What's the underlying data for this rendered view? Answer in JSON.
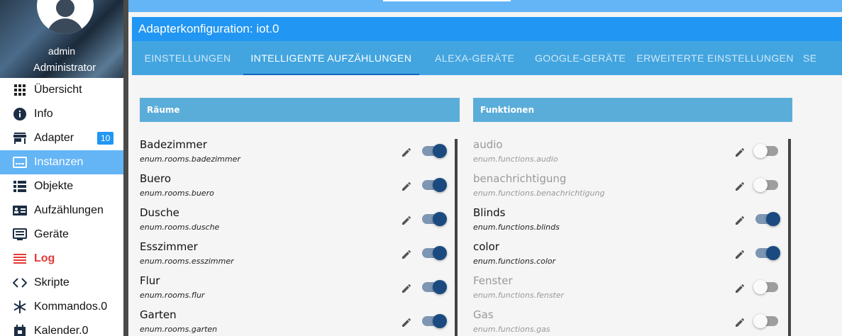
{
  "sidebar": {
    "user_name": "admin",
    "user_role": "Administrator",
    "items": [
      {
        "label": "Übersicht",
        "icon": "grid-icon"
      },
      {
        "label": "Info",
        "icon": "info-icon"
      },
      {
        "label": "Adapter",
        "icon": "store-icon",
        "badge": "10"
      },
      {
        "label": "Instanzen",
        "icon": "instances-icon",
        "active": true
      },
      {
        "label": "Objekte",
        "icon": "list-icon"
      },
      {
        "label": "Aufzählungen",
        "icon": "enum-icon"
      },
      {
        "label": "Geräte",
        "icon": "devices-icon"
      },
      {
        "label": "Log",
        "icon": "log-icon"
      },
      {
        "label": "Skripte",
        "icon": "code-icon"
      },
      {
        "label": "Kommandos.0",
        "icon": "snowflake-icon"
      },
      {
        "label": "Kalender.0",
        "icon": "calendar-icon"
      }
    ]
  },
  "header": {
    "title": "Adapterkonfiguration: iot.0"
  },
  "tabs": [
    {
      "label": "EINSTELLUNGEN"
    },
    {
      "label": "INTELLIGENTE AUFZÄHLUNGEN",
      "active": true
    },
    {
      "label": "ALEXA-GERÄTE"
    },
    {
      "label": "GOOGLE-GERÄTE"
    },
    {
      "label": "ERWEITERTE EINSTELLUNGEN"
    },
    {
      "label": "SE"
    }
  ],
  "rooms": {
    "title": "Räume",
    "items": [
      {
        "name": "Badezimmer",
        "id": "enum.rooms.badezimmer",
        "enabled": true
      },
      {
        "name": "Buero",
        "id": "enum.rooms.buero",
        "enabled": true
      },
      {
        "name": "Dusche",
        "id": "enum.rooms.dusche",
        "enabled": true
      },
      {
        "name": "Esszimmer",
        "id": "enum.rooms.esszimmer",
        "enabled": true
      },
      {
        "name": "Flur",
        "id": "enum.rooms.flur",
        "enabled": true
      },
      {
        "name": "Garten",
        "id": "enum.rooms.garten",
        "enabled": true
      }
    ]
  },
  "functions": {
    "title": "Funktionen",
    "items": [
      {
        "name": "audio",
        "id": "enum.functions.audio",
        "enabled": false
      },
      {
        "name": "benachrichtigung",
        "id": "enum.functions.benachrichtigung",
        "enabled": false
      },
      {
        "name": "Blinds",
        "id": "enum.functions.blinds",
        "enabled": true
      },
      {
        "name": "color",
        "id": "enum.functions.color",
        "enabled": true
      },
      {
        "name": "Fenster",
        "id": "enum.functions.fenster",
        "enabled": false
      },
      {
        "name": "Gas",
        "id": "enum.functions.gas",
        "enabled": false
      }
    ]
  },
  "colors": {
    "accent": "#2196f3",
    "tabbar": "#42a5e0",
    "active_menu": "#64b5f6",
    "log": "#e53935",
    "toggle_on": "#1a4a80"
  }
}
